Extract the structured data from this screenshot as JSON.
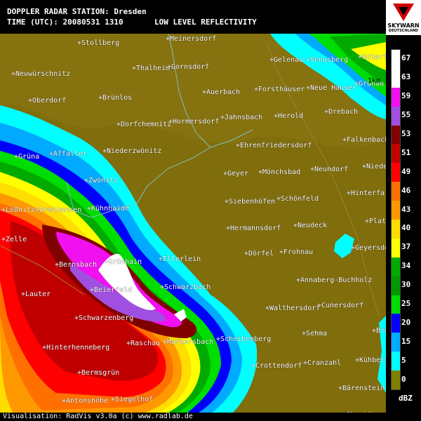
{
  "header": {
    "station": "DOPPLER RADAR STATION: Dresden",
    "time": "TIME (UTC): 20080531 1310",
    "product": "LOW LEVEL REFLECTIVITY"
  },
  "footer": {
    "credit": "Visualisation: RadVis v3.0a (c) www.radlab.de"
  },
  "logo": {
    "brand": "SKYWARN",
    "country": "DEUTSCHLAND"
  },
  "scale_label": "1km",
  "legend": {
    "unit": "dBZ",
    "ticks": [
      "67",
      "63",
      "59",
      "55",
      "53",
      "51",
      "49",
      "46",
      "43",
      "40",
      "37",
      "34",
      "30",
      "25",
      "20",
      "15",
      "5",
      "0"
    ],
    "colors": [
      "#ffffff",
      "#ffffff",
      "#f010f0",
      "#a050e0",
      "#800000",
      "#c00000",
      "#ff0000",
      "#ff7000",
      "#ff9900",
      "#ffdd00",
      "#ffff00",
      "#00aa00",
      "#009900",
      "#00dd00",
      "#0000ff",
      "#00aaff",
      "#00ffff",
      "#808000"
    ]
  },
  "places": [
    {
      "name": "Meinersdorf"
    },
    {
      "name": "Stollberg"
    },
    {
      "name": "Gelenau"
    },
    {
      "name": "Venusberg"
    },
    {
      "name": "Scharf"
    },
    {
      "name": "Thalheim"
    },
    {
      "name": "Gornsdorf"
    },
    {
      "name": "Neuwürschnitz"
    },
    {
      "name": "Grünau"
    },
    {
      "name": "Auerbach"
    },
    {
      "name": "Forsthäuser"
    },
    {
      "name": "Neue Häuser"
    },
    {
      "name": "Oberdorf"
    },
    {
      "name": "Brünlos"
    },
    {
      "name": "Drebach"
    },
    {
      "name": "Jahnsbach"
    },
    {
      "name": "Herold"
    },
    {
      "name": "Dorfchemnitz"
    },
    {
      "name": "Hormersdorf"
    },
    {
      "name": "Falkenbach"
    },
    {
      "name": "Ehrenfriedersdorf"
    },
    {
      "name": "Grüna"
    },
    {
      "name": "Affalter"
    },
    {
      "name": "Niederzwönitz"
    },
    {
      "name": "Niede"
    },
    {
      "name": "Geyer"
    },
    {
      "name": "Mönchsbad"
    },
    {
      "name": "Neundorf"
    },
    {
      "name": "Zwönitz"
    },
    {
      "name": "Hinterfal"
    },
    {
      "name": "Siebenhöfen"
    },
    {
      "name": "Schönfeld"
    },
    {
      "name": "Lößnitz"
    },
    {
      "name": "Dreihansen"
    },
    {
      "name": "Kühnhaide"
    },
    {
      "name": "Plat"
    },
    {
      "name": "Hermannsdorf"
    },
    {
      "name": "Neudeck"
    },
    {
      "name": "Zelle"
    },
    {
      "name": "Geyersdor"
    },
    {
      "name": "Dörfel"
    },
    {
      "name": "Frohnau"
    },
    {
      "name": "Elterlein"
    },
    {
      "name": "Bernsbach"
    },
    {
      "name": "Grünhain"
    },
    {
      "name": "Annaberg-Buchholz"
    },
    {
      "name": "Schwarzbach"
    },
    {
      "name": "Lauter"
    },
    {
      "name": "Beierfeld"
    },
    {
      "name": "Walthersdorf"
    },
    {
      "name": "Cunersdorf"
    },
    {
      "name": "Schwarzenberg"
    },
    {
      "name": "Sehma"
    },
    {
      "name": "Bre"
    },
    {
      "name": "Scheibenberg"
    },
    {
      "name": "Raschau"
    },
    {
      "name": "Markersbach"
    },
    {
      "name": "Hinterhenneberg"
    },
    {
      "name": "Crottendorf"
    },
    {
      "name": "Cranzahl"
    },
    {
      "name": "Kühbers"
    },
    {
      "name": "Bermsgrün"
    },
    {
      "name": "Bärenstein"
    },
    {
      "name": "Antonshöhe"
    },
    {
      "name": "Siegelhof"
    },
    {
      "name": "Siebensäure"
    },
    {
      "name": "Oberbärens"
    }
  ]
}
